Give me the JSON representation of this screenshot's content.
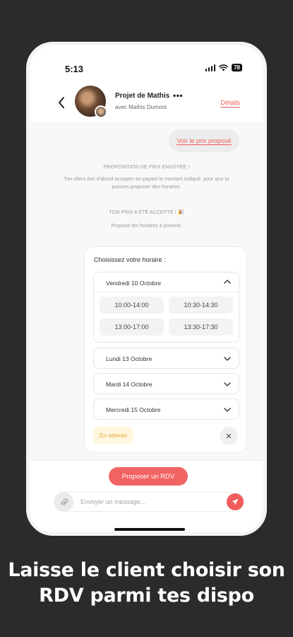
{
  "status_bar": {
    "time": "5:13",
    "battery": "78"
  },
  "header": {
    "title": "Projet de Mathis",
    "more": "•••",
    "subtitle": "avec Mathis Dumont",
    "details_link": "Détails"
  },
  "chat": {
    "bubble_link": "Voir le prix proposé",
    "sent_title": "PROPOSITION DE PRIX ENVOYÉE !",
    "sent_text": "Ton client doit d'abord accepter en payant le montant indiqué, pour que tu puisses proposer des horaires.",
    "accepted_title": "TON PRIX A ÉTÉ ACCEPTÉ ! 🎉",
    "accepted_text": "Propose tes horaires à present."
  },
  "schedule": {
    "title": "Choisissez votre horaire :",
    "open_day": "Vendredi 10 Octobre",
    "slots": [
      "10:00-14:00",
      "10:30-14:30",
      "13:00-17:00",
      "13:30-17:30"
    ],
    "days": [
      "Lundi 13 Octobre",
      "Mardi 14 Octobre",
      "Mercredi 15 Octobre"
    ],
    "status": "En attente",
    "close": "✕"
  },
  "footer": {
    "propose_button": "Proposer un RDV",
    "message_placeholder": "Envoyer un message..."
  },
  "caption": {
    "line1": "Laisse le client choisir son",
    "line2": "RDV parmi tes dispo"
  },
  "colors": {
    "accent": "#f25c5c",
    "status_bg": "#fff6de",
    "status_text": "#e5a73b"
  }
}
